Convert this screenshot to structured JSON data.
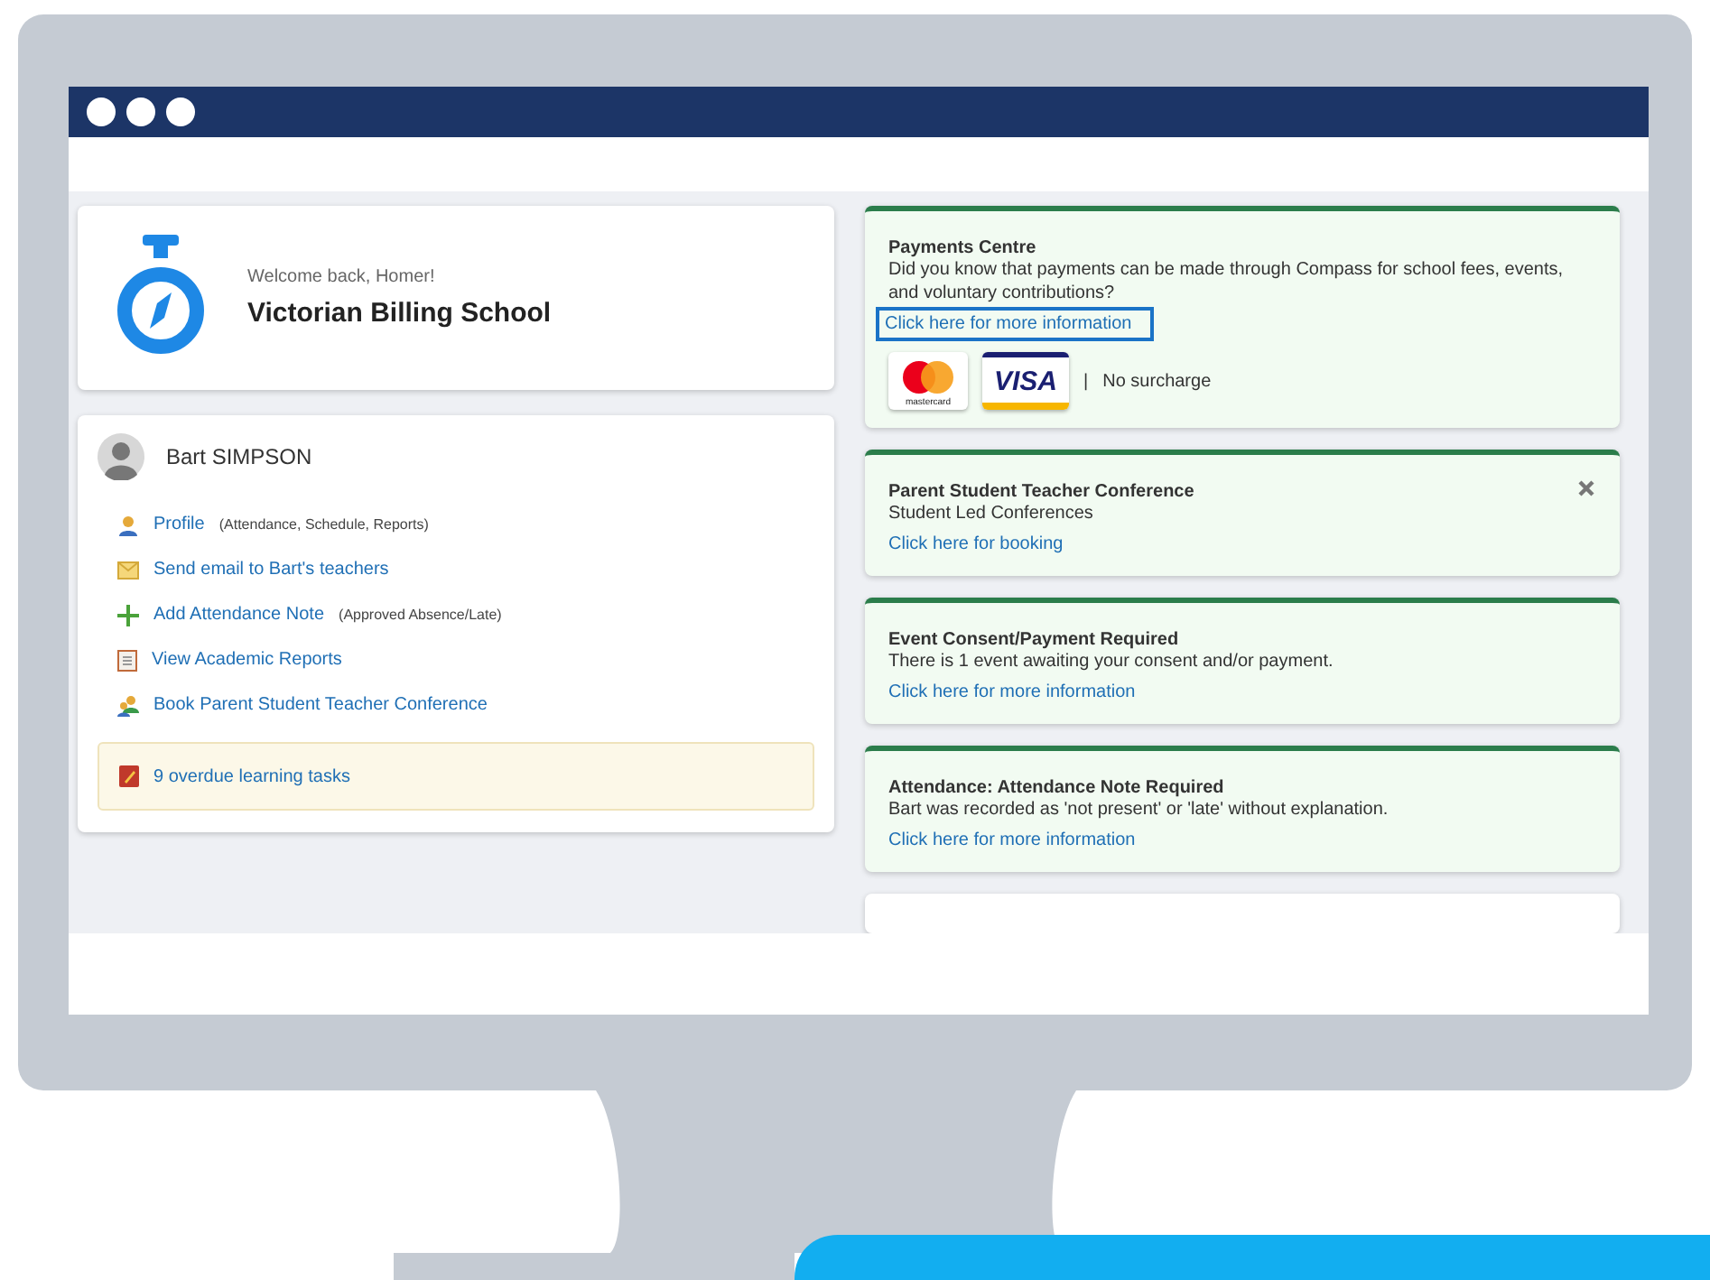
{
  "school_card": {
    "welcome": "Welcome back, Homer!",
    "school": "Victorian Billing School"
  },
  "student_card": {
    "name": "Bart SIMPSON",
    "links": [
      {
        "kind": "profile",
        "label": "Profile",
        "note": "(Attendance, Schedule, Reports)"
      },
      {
        "kind": "email",
        "label": "Send email to Bart's teachers"
      },
      {
        "kind": "add",
        "label": "Add Attendance Note",
        "note": "(Approved Absence/Late)"
      },
      {
        "kind": "report",
        "label": "View Academic Reports"
      },
      {
        "kind": "conference",
        "label": "Book Parent Student Teacher Conference"
      }
    ],
    "alert": "9 overdue learning tasks"
  },
  "notices": [
    {
      "kind": "payments",
      "title": "Payments Centre",
      "text": "Did you know that payments can be made through Compass for school fees, events, and voluntary contributions?",
      "link": "Click here for more information",
      "highlighted": true,
      "mastercard": "mastercard",
      "visa": "VISA",
      "separator": "|",
      "surcharge": "No surcharge",
      "closable": false
    },
    {
      "kind": "plain",
      "title": "Parent Student Teacher Conference",
      "text": "Student Led Conferences",
      "link": "Click here for booking",
      "highlighted": false,
      "closable": true
    },
    {
      "kind": "plain",
      "title": "Event Consent/Payment Required",
      "text": "There is 1 event awaiting your consent and/or payment.",
      "link": "Click here for more information",
      "highlighted": false,
      "closable": false
    },
    {
      "kind": "plain",
      "title": "Attendance: Attendance Note Required",
      "text": "Bart was recorded as 'not present' or 'late' without explanation.",
      "link": "Click here for more information",
      "highlighted": false,
      "closable": false
    }
  ]
}
